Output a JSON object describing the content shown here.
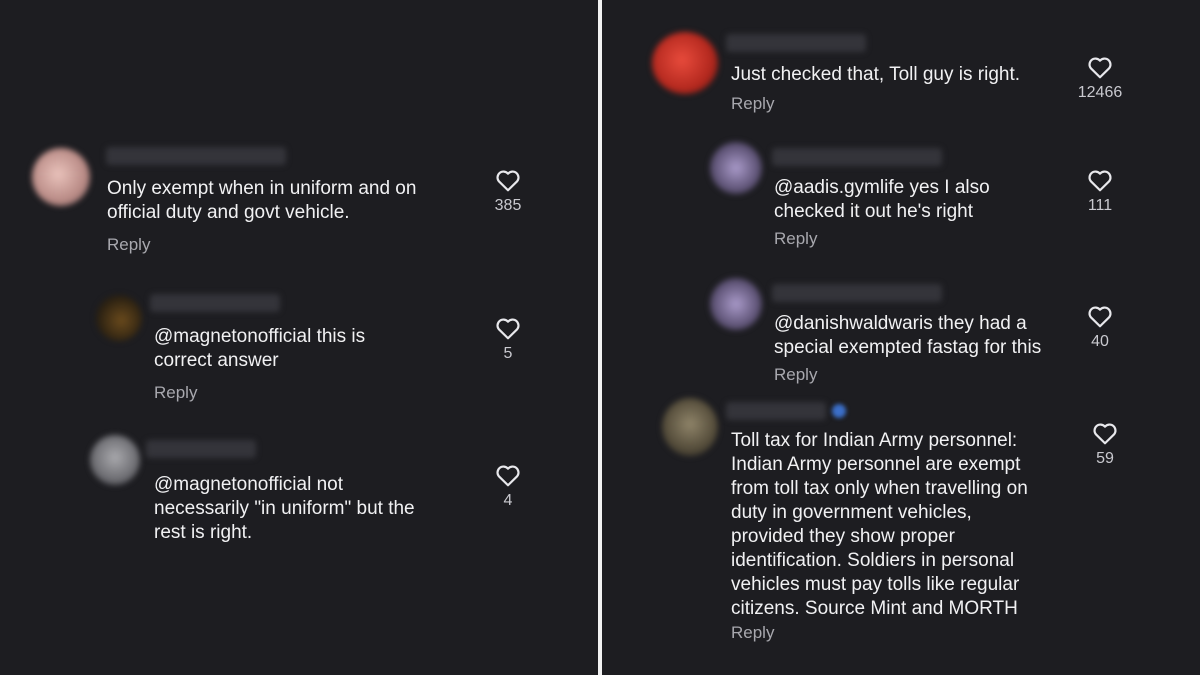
{
  "left": {
    "comments": [
      {
        "text": "Only exempt when in uniform and on\nofficial duty and govt vehicle.",
        "reply": "Reply",
        "likes": "385"
      },
      {
        "text": "@magnetonofficial this is\ncorrect answer",
        "reply": "Reply",
        "likes": "5"
      },
      {
        "text": "@magnetonofficial not\nnecessarily \"in uniform\" but the\nrest is right.",
        "likes": "4"
      }
    ]
  },
  "right": {
    "comments": [
      {
        "text": "Just checked that, Toll guy is right.",
        "reply": "Reply",
        "likes": "12466"
      },
      {
        "text": "@aadis.gymlife yes I also\nchecked it out he's right",
        "reply": "Reply",
        "likes": "111"
      },
      {
        "text": "@danishwaldwaris they had a\nspecial exempted fastag for this",
        "reply": "Reply",
        "likes": "40"
      },
      {
        "text": "Toll tax for Indian Army personnel:\nIndian Army personnel are exempt\nfrom toll tax only when travelling on\nduty in government vehicles,\nprovided they show proper\nidentification. Soldiers in personal\nvehicles must pay tolls like regular\ncitizens.  Source Mint and MORTH",
        "reply": "Reply",
        "likes": "59"
      }
    ]
  },
  "icons": {
    "like": "heart-outline-icon"
  },
  "colors": {
    "background": "#1d1d21",
    "text": "#f1f1f3",
    "muted": "#a8a8ae"
  }
}
